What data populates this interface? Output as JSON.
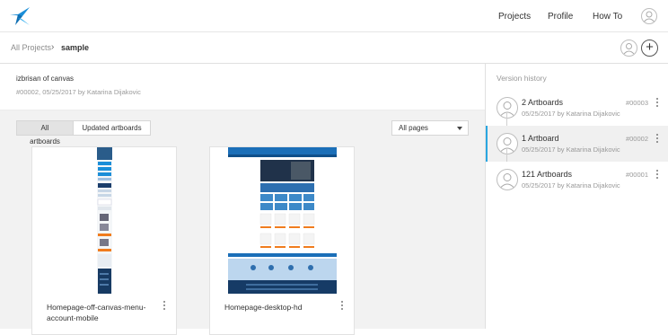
{
  "nav": {
    "items": [
      "Projects",
      "Profile",
      "How To"
    ]
  },
  "breadcrumb": {
    "root": "All Projects",
    "separator": "›",
    "current": "sample"
  },
  "project": {
    "title": "izbrisan of canvas",
    "meta": "#00002, 05/25/2017 by Katarina Dijakovic"
  },
  "filters": {
    "tabs": [
      "All artboards",
      "Updated artboards"
    ],
    "page_select": "All pages"
  },
  "artboards": [
    {
      "name": "Homepage-off-canvas-menu-account-mobile"
    },
    {
      "name": "Homepage-desktop-hd"
    }
  ],
  "version_history": {
    "title": "Version history",
    "versions": [
      {
        "name": "2 Artboards",
        "meta": "05/25/2017 by Katarina Dijakovic",
        "number": "#00003"
      },
      {
        "name": "1 Artboard",
        "meta": "05/25/2017 by Katarina Dijakovic",
        "number": "#00002"
      },
      {
        "name": "121 Artboards",
        "meta": "05/25/2017 by Katarina Dijakovic",
        "number": "#00001"
      }
    ]
  },
  "colors": {
    "accent": "#29a6e0",
    "brand_logo": "#1b8ed8"
  },
  "icons": [
    "logo-icon",
    "user-avatar-icon",
    "chevron-right-icon",
    "plus-icon",
    "more-vertical-icon"
  ]
}
